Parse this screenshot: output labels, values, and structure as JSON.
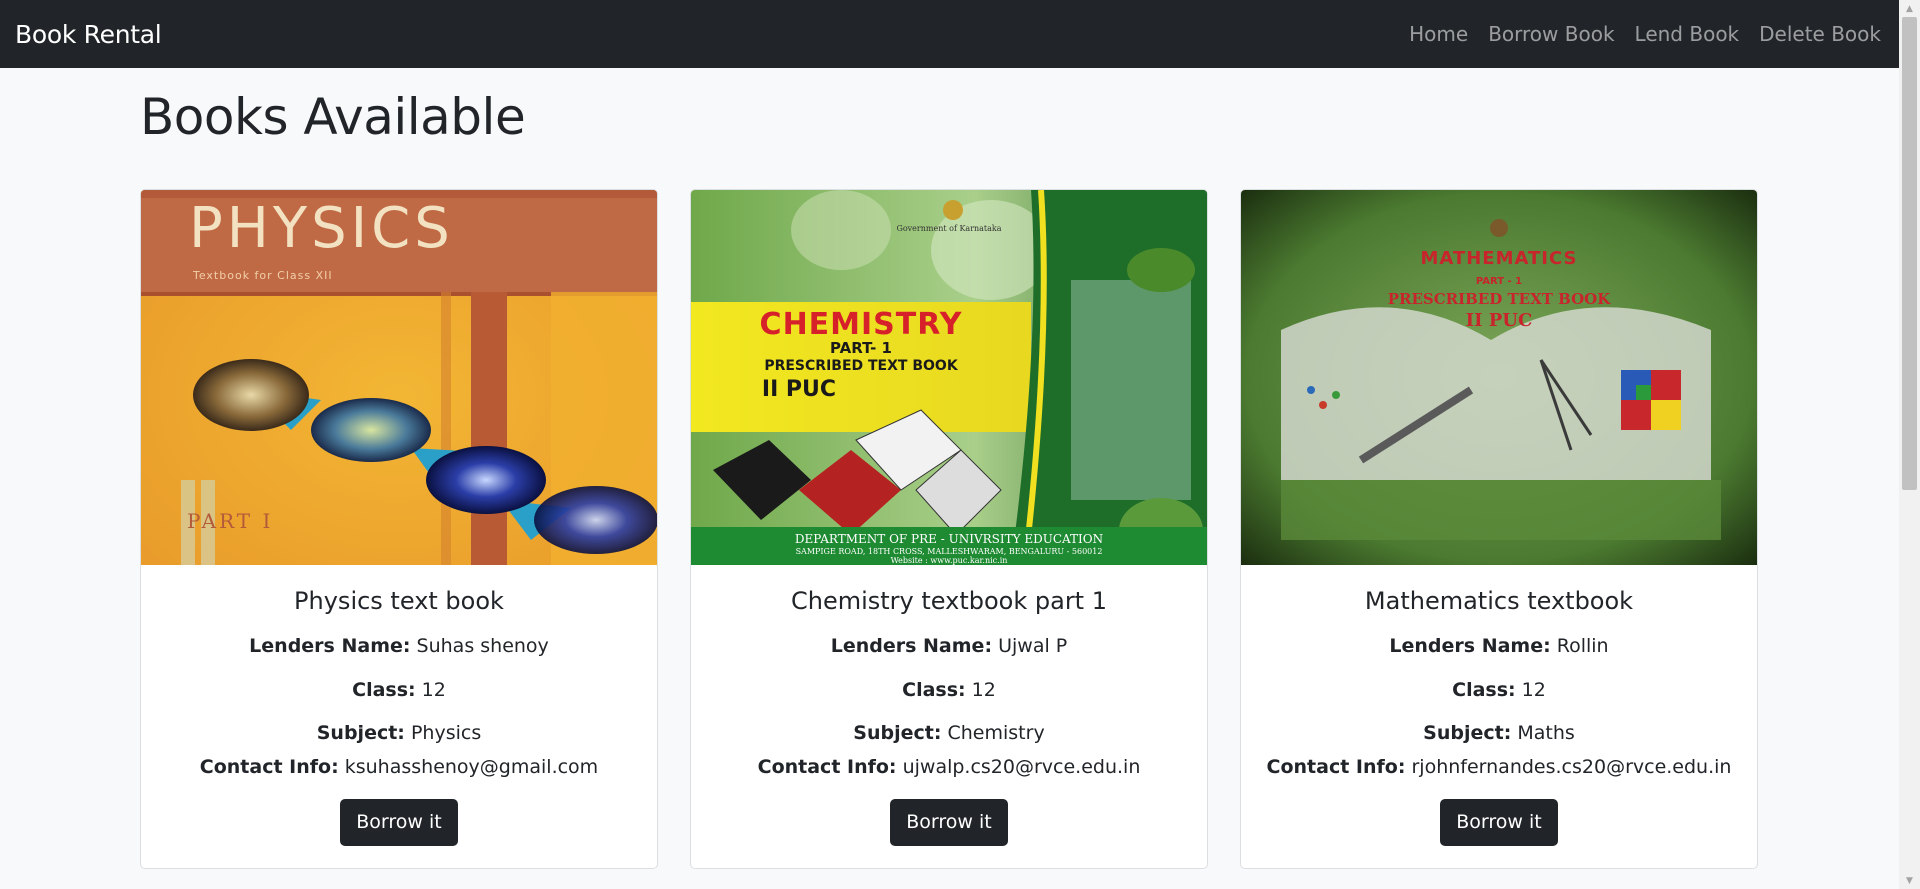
{
  "navbar": {
    "brand": "Book Rental",
    "links": [
      "Home",
      "Borrow Book",
      "Lend Book",
      "Delete Book"
    ]
  },
  "page": {
    "title": "Books Available"
  },
  "labels": {
    "lender": "Lenders Name:",
    "class": "Class:",
    "subject": "Subject:",
    "contact": "Contact Info:"
  },
  "books": [
    {
      "title": "Physics text book",
      "lender": "Suhas shenoy",
      "class": "12",
      "subject": "Physics",
      "contact": "ksuhasshenoy@gmail.com",
      "button": "Borrow it",
      "cover": {
        "title": "PHYSICS",
        "subtitle": "Textbook for Class XII",
        "part": "PART I"
      }
    },
    {
      "title": "Chemistry textbook part 1",
      "lender": "Ujwal P",
      "class": "12",
      "subject": "Chemistry",
      "contact": "ujwalp.cs20@rvce.edu.in",
      "button": "Borrow it",
      "cover": {
        "gov": "Government of Karnataka",
        "title": "CHEMISTRY",
        "part": "PART- 1",
        "prescribed": "PRESCRIBED TEXT BOOK",
        "level": "II PUC",
        "dept": "DEPARTMENT OF PRE - UNIVRSITY EDUCATION",
        "address": "SAMPIGE ROAD, 18TH CROSS, MALLESHWARAM, BENGALURU - 560012",
        "website": "Website : www.puc.kar.nic.in"
      }
    },
    {
      "title": "Mathematics textbook",
      "lender": "Rollin",
      "class": "12",
      "subject": "Maths",
      "contact": "rjohnfernandes.cs20@rvce.edu.in",
      "button": "Borrow it",
      "cover": {
        "title": "MATHEMATICS",
        "part": "PART - 1",
        "prescribed": "PRESCRIBED TEXT BOOK",
        "level": "II PUC"
      }
    }
  ],
  "colors": {
    "navbar_bg": "#212529",
    "page_bg": "#f8f9fa",
    "button_bg": "#212529",
    "chemistry_title": "#d6202a",
    "mathematics_title": "#c8242c"
  }
}
